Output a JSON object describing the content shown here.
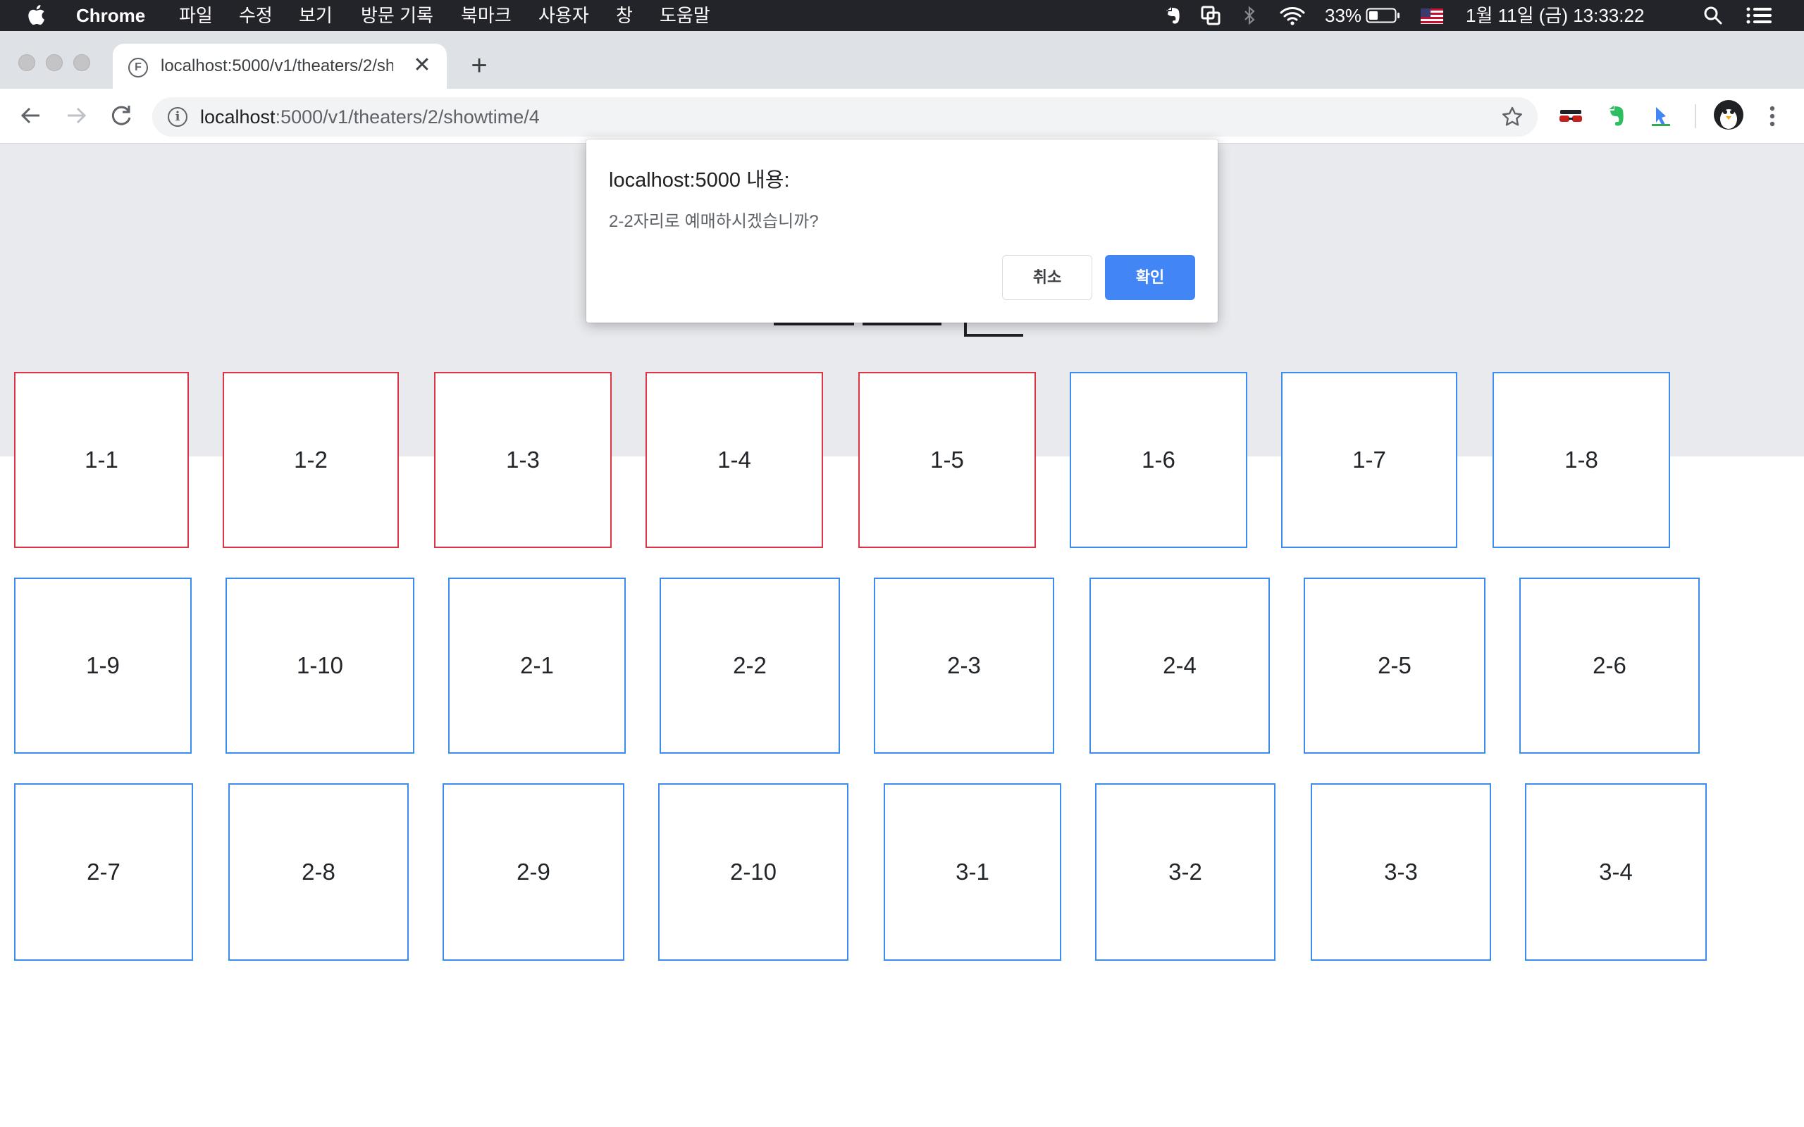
{
  "menubar": {
    "app_name": "Chrome",
    "menus": [
      "파일",
      "수정",
      "보기",
      "방문 기록",
      "북마크",
      "사용자",
      "창",
      "도움말"
    ],
    "battery": "33%",
    "datetime": "1월 11일 (금)  13:33:22"
  },
  "browser": {
    "tab_favicon": "F",
    "tab_title": "localhost:5000/v1/theaters/2/showtime/4",
    "url_host": "localhost",
    "url_rest": ":5000/v1/theaters/2/showtime/4"
  },
  "dialog": {
    "title": "localhost:5000 내용:",
    "message": "2-2자리로 예매하시겠습니까?",
    "cancel_label": "취소",
    "ok_label": "확인"
  },
  "seat_colors": {
    "reserved": "#dc3545",
    "available": "#3b8eed"
  },
  "seats": [
    {
      "label": "1-1",
      "status": "reserved"
    },
    {
      "label": "1-2",
      "status": "reserved"
    },
    {
      "label": "1-3",
      "status": "reserved"
    },
    {
      "label": "1-4",
      "status": "reserved"
    },
    {
      "label": "1-5",
      "status": "reserved"
    },
    {
      "label": "1-6",
      "status": "available"
    },
    {
      "label": "1-7",
      "status": "available"
    },
    {
      "label": "1-8",
      "status": "available"
    },
    {
      "label": "1-9",
      "status": "available"
    },
    {
      "label": "1-10",
      "status": "available"
    },
    {
      "label": "2-1",
      "status": "available"
    },
    {
      "label": "2-2",
      "status": "available"
    },
    {
      "label": "2-3",
      "status": "available"
    },
    {
      "label": "2-4",
      "status": "available"
    },
    {
      "label": "2-5",
      "status": "available"
    },
    {
      "label": "2-6",
      "status": "available"
    },
    {
      "label": "2-7",
      "status": "available"
    },
    {
      "label": "2-8",
      "status": "available"
    },
    {
      "label": "2-9",
      "status": "available"
    },
    {
      "label": "2-10",
      "status": "available"
    },
    {
      "label": "3-1",
      "status": "available"
    },
    {
      "label": "3-2",
      "status": "available"
    },
    {
      "label": "3-3",
      "status": "available"
    },
    {
      "label": "3-4",
      "status": "available"
    }
  ]
}
